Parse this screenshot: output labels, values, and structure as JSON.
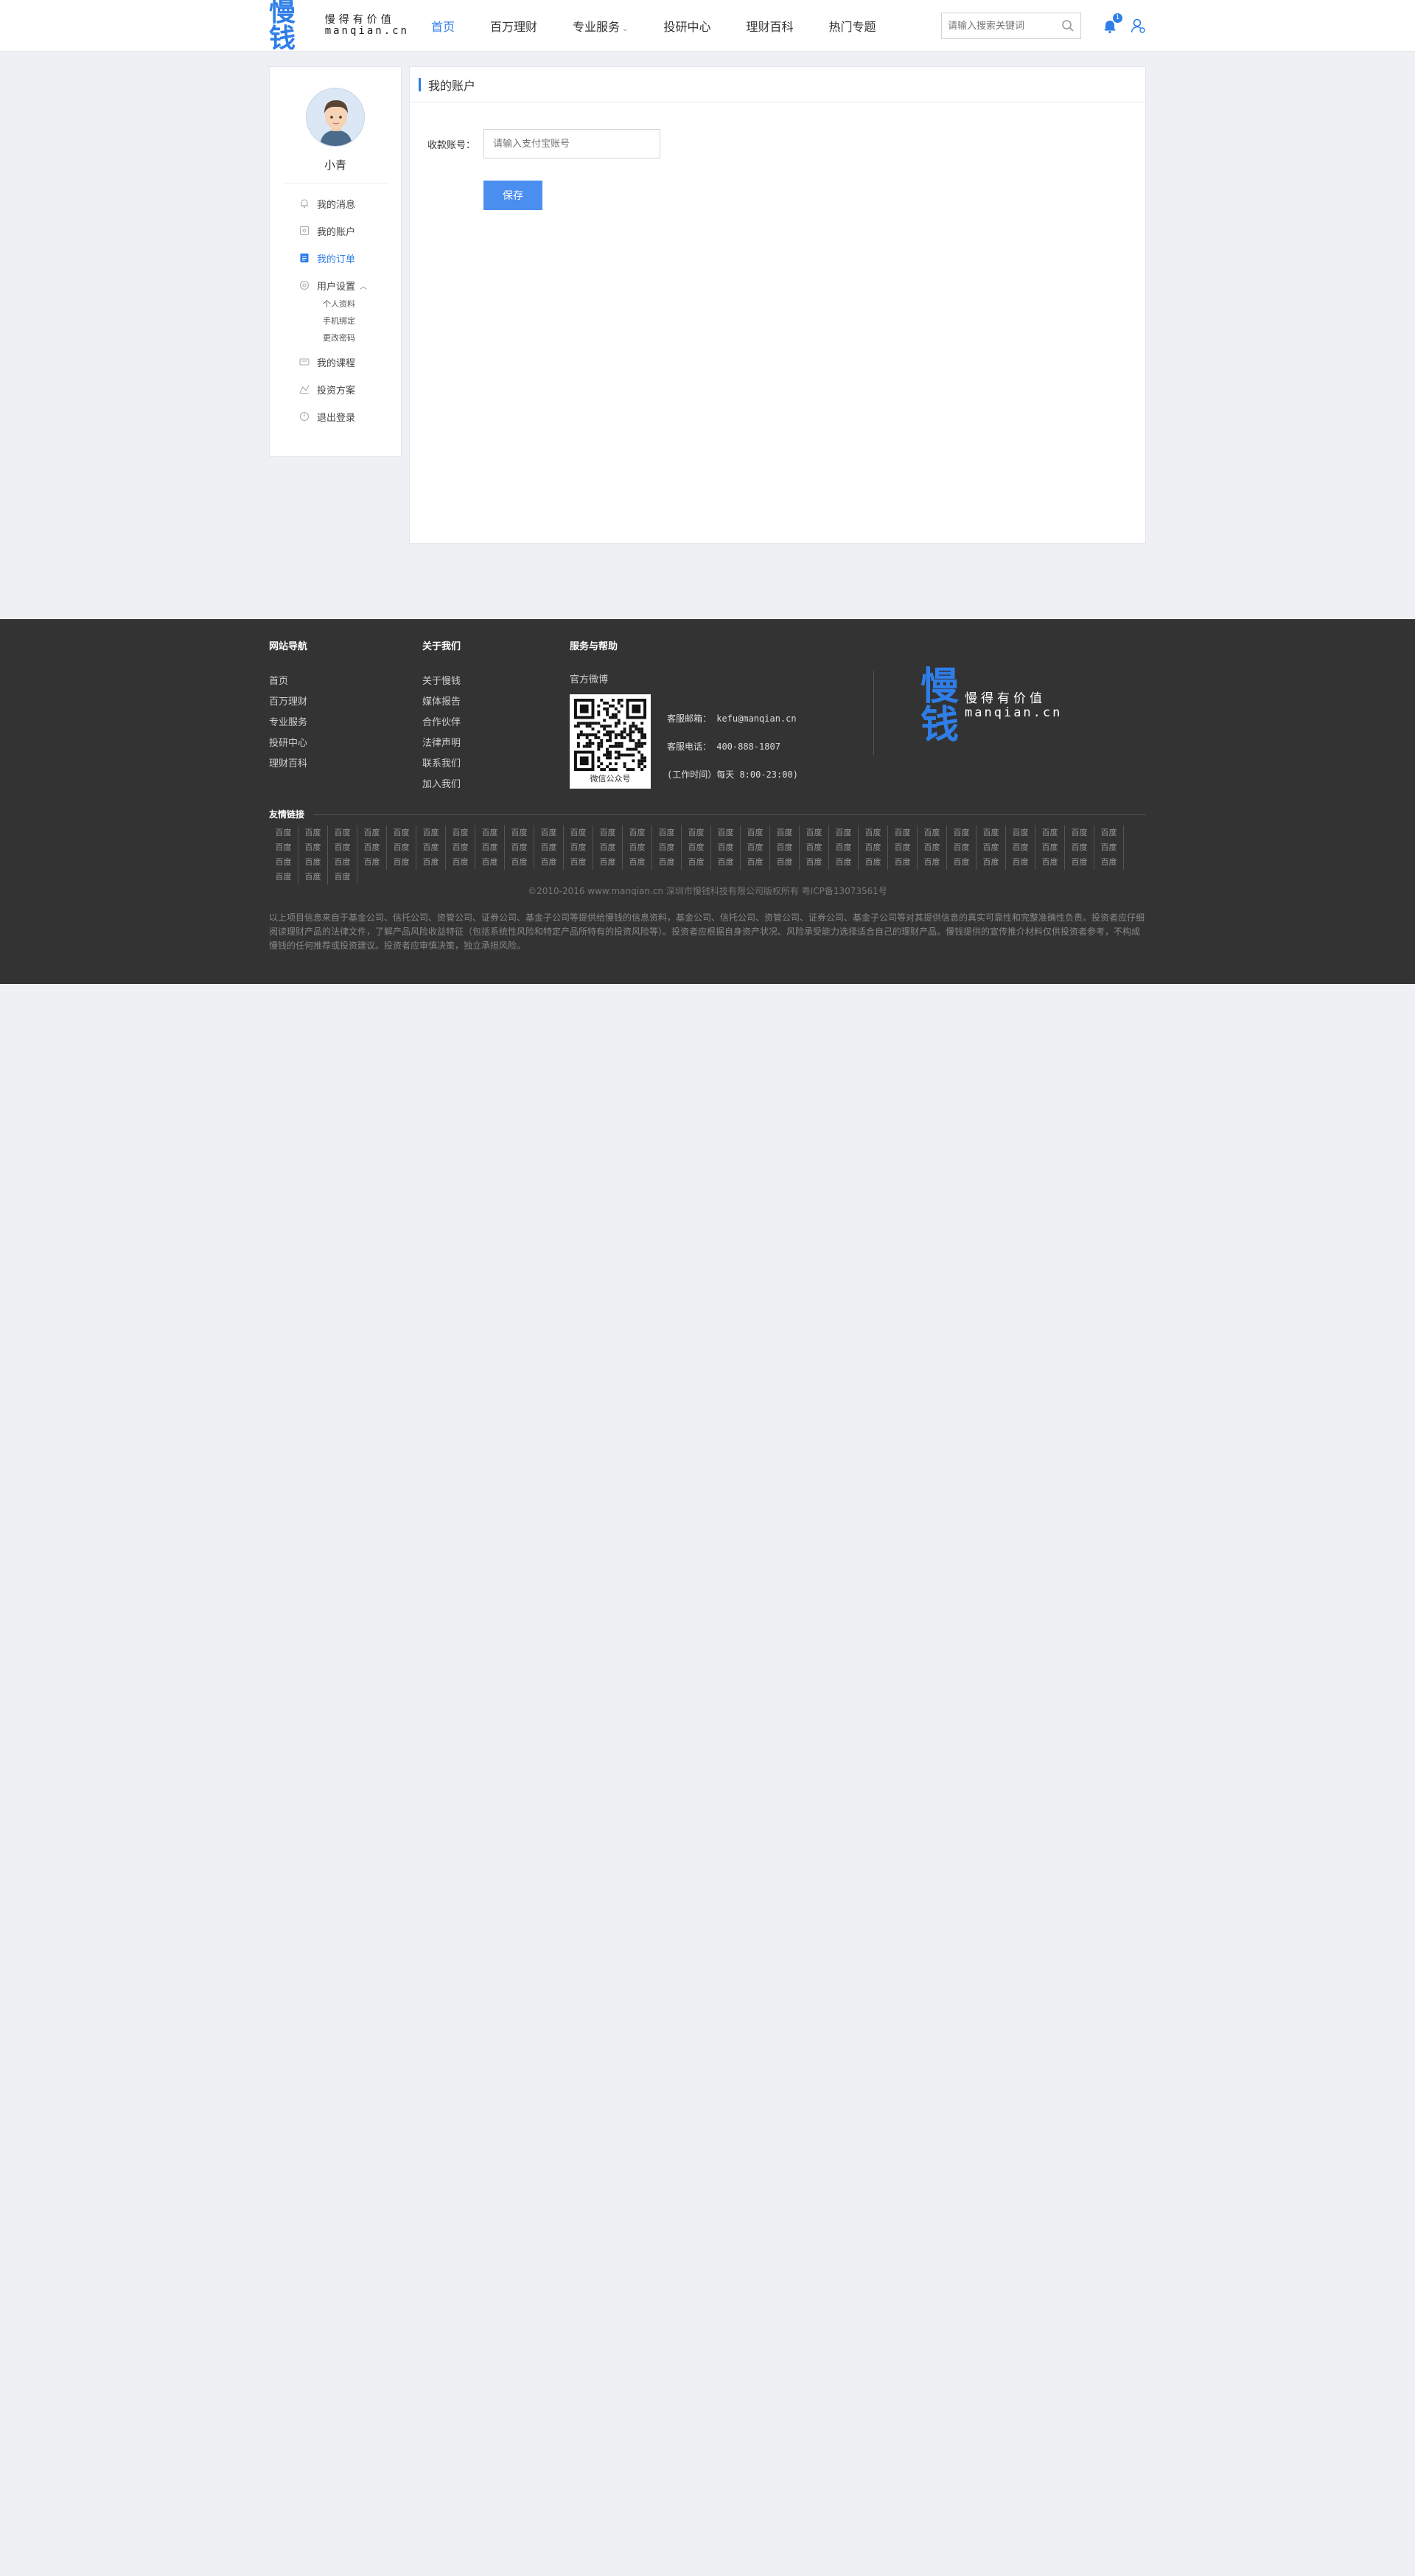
{
  "header": {
    "logo_mark": "慢钱",
    "logo_slogan": "慢得有价值",
    "logo_domain": "manqian.cn",
    "nav": [
      {
        "label": "首页",
        "active": true
      },
      {
        "label": "百万理财"
      },
      {
        "label": "专业服务",
        "has_dropdown": true
      },
      {
        "label": "投研中心"
      },
      {
        "label": "理财百科"
      },
      {
        "label": "热门专题"
      }
    ],
    "search_placeholder": "请输入搜索关键词",
    "notification_count": "1"
  },
  "sidebar": {
    "username": "小青",
    "items": [
      {
        "label": "我的消息",
        "icon": "bell-icon"
      },
      {
        "label": "我的账户",
        "icon": "account-icon"
      },
      {
        "label": "我的订单",
        "icon": "order-icon",
        "active": true
      },
      {
        "label": "用户设置",
        "icon": "settings-icon",
        "expanded": true
      },
      {
        "label": "我的课程",
        "icon": "course-icon"
      },
      {
        "label": "投资方案",
        "icon": "investment-icon"
      },
      {
        "label": "退出登录",
        "icon": "logout-icon"
      }
    ],
    "settings_sub": [
      "个人资料",
      "手机绑定",
      "更改密码"
    ]
  },
  "content": {
    "title": "我的账户",
    "form_label": "收款账号：",
    "form_placeholder": "请输入支付宝账号",
    "save_label": "保存"
  },
  "footer": {
    "nav_title": "网站导航",
    "nav_links": [
      "首页",
      "百万理财",
      "专业服务",
      "投研中心",
      "理财百科"
    ],
    "about_title": "关于我们",
    "about_links": [
      "关于慢钱",
      "媒体报告",
      "合作伙伴",
      "法律声明",
      "联系我们",
      "加入我们"
    ],
    "help_title": "服务与帮助",
    "weibo": "官方微博",
    "qr_caption": "微信公众号",
    "email": "客服邮箱： kefu@manqian.cn",
    "phone": "客服电话： 400-888-1807",
    "hours": "(工作时间）每天 8:00-23:00)",
    "links_title": "友情链接",
    "link_word": "百度",
    "copyright": "©2010-2016 www.manqian.cn 深圳市慢钱科技有限公司版权所有   粤ICP备13073561号",
    "disclaimer": "以上项目信息来自于基金公司、信托公司、资管公司、证券公司、基金子公司等提供给慢钱的信息资料，基金公司、信托公司、资管公司、证券公司、基金子公司等对其提供信息的真实可靠性和完整准确性负责。投资者应仔细阅读理财产品的法律文件，了解产品风险收益特征（包括系统性风险和特定产品所特有的投资风险等）。投资者应根据自身资产状况、风险承受能力选择适合自己的理财产品。慢钱提供的宣传推介材料仅供投资者参考，不构成慢钱的任何推荐或投资建议。投资者应审慎决策，独立承担风险。"
  }
}
